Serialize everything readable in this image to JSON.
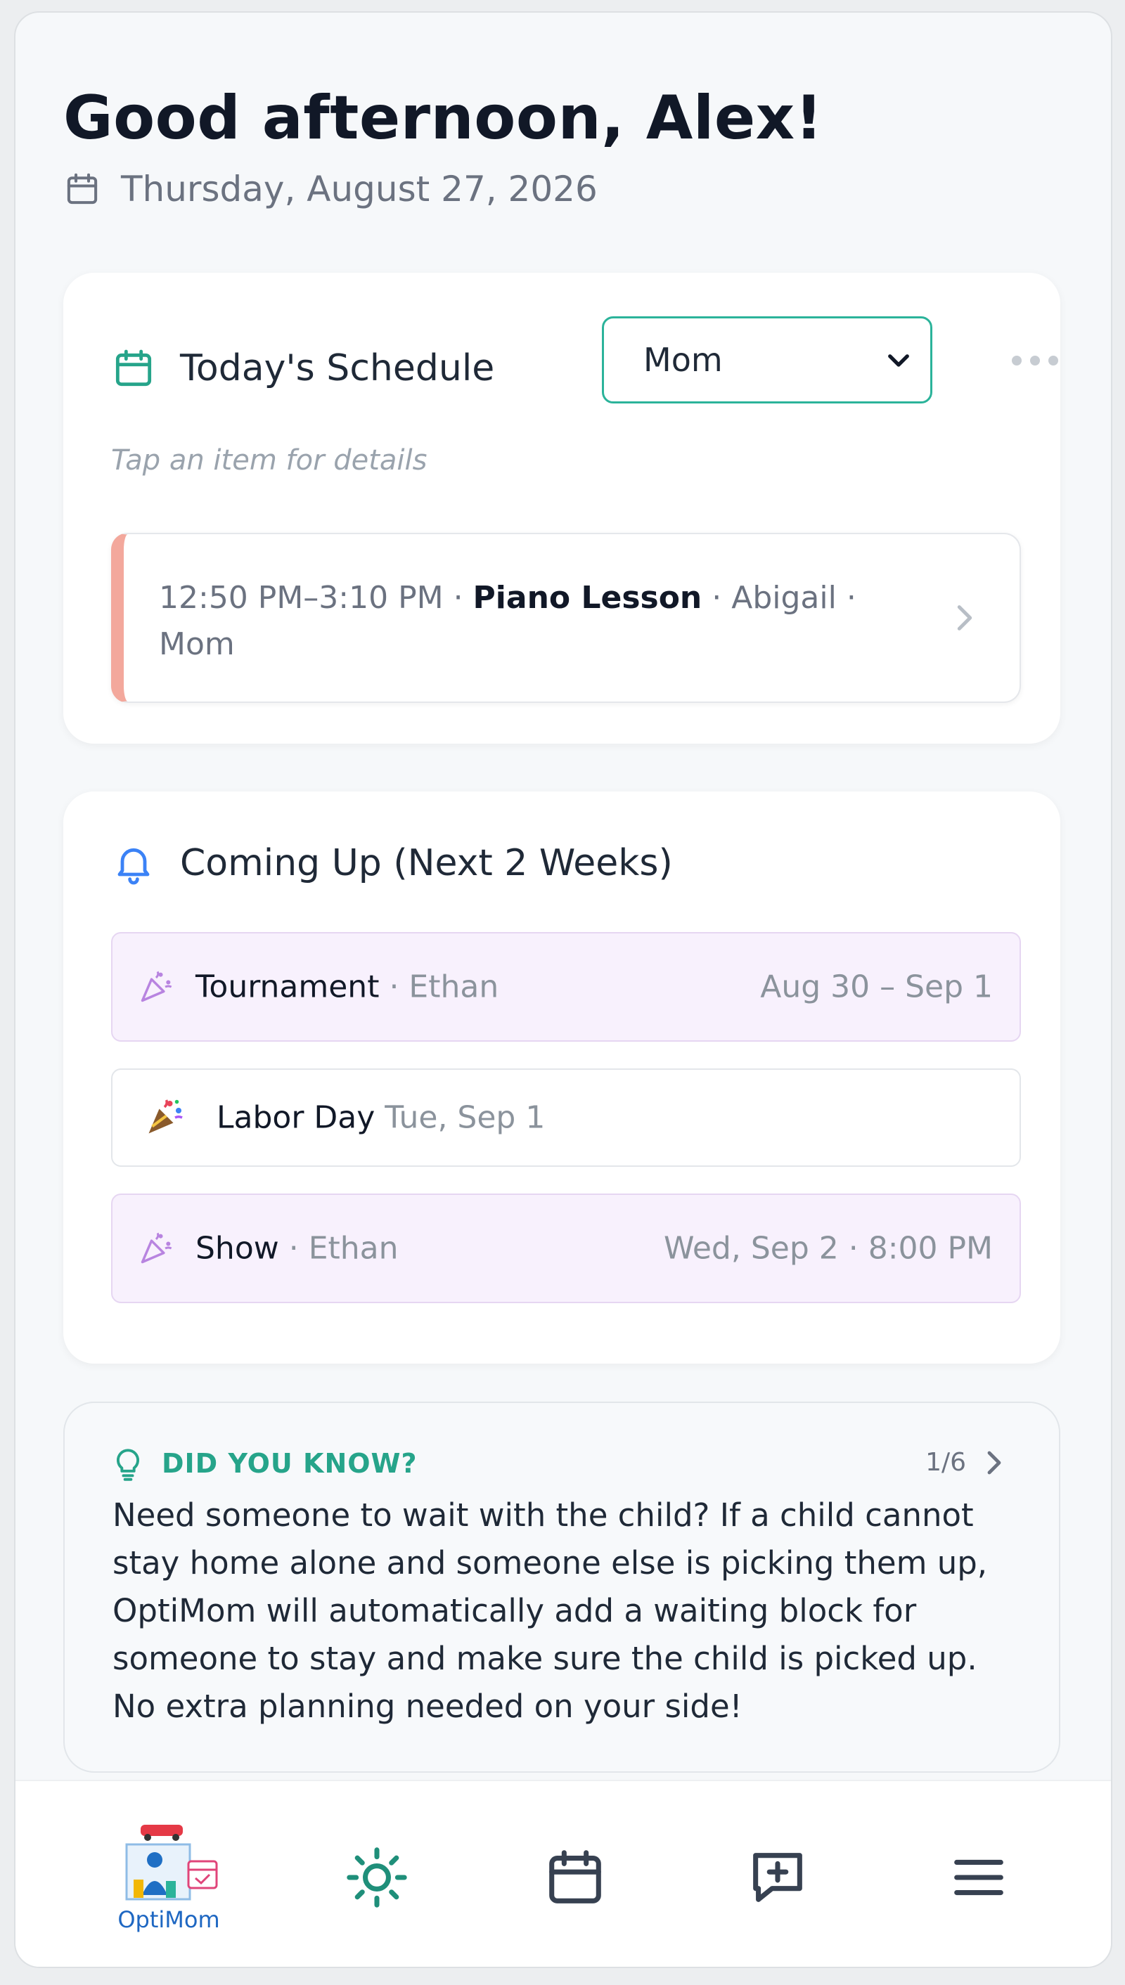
{
  "header": {
    "greeting": "Good afternoon, Alex!",
    "date": "Thursday, August 27, 2026"
  },
  "schedule": {
    "title": "Today's Schedule",
    "member_selected": "Mom",
    "hint": "Tap an item for details",
    "event": {
      "time": "12:50 PM–3:10 PM",
      "sep": " · ",
      "title": "Piano Lesson",
      "child": "Abigail",
      "person": "Mom",
      "accent_color": "#f3a89c"
    }
  },
  "upcoming": {
    "title": "Coming Up (Next 2 Weeks)",
    "items": [
      {
        "name": "Tournament",
        "who": "Ethan",
        "when": "Aug 30 – Sep 1"
      },
      {
        "name": "Labor Day",
        "who": "",
        "when": "Tue, Sep 1"
      },
      {
        "name": "Show",
        "who": "Ethan",
        "when": "Wed, Sep 2 · 8:00 PM"
      }
    ]
  },
  "tip": {
    "label": "DID YOU KNOW?",
    "counter": "1/6",
    "text": "Need someone to wait with the child? If a child cannot stay home alone and someone else is picking them up, OptiMom will automatically add a waiting block for someone to stay and make sure the child is picked up. No extra planning needed on your side!"
  },
  "nav": {
    "logo_text": "OptiMom",
    "items": [
      "today-icon",
      "calendar-icon",
      "message-add-icon",
      "menu-icon"
    ]
  },
  "colors": {
    "accent": "#2bb39a",
    "tip_label": "#26a48a",
    "purple_bg": "#f8f1fd"
  }
}
